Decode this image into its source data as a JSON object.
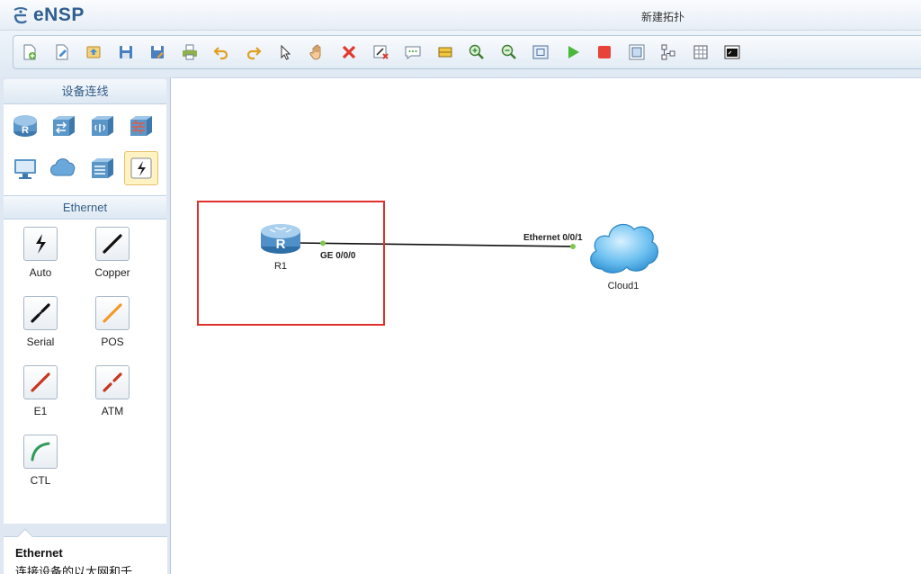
{
  "app": {
    "name": "eNSP",
    "window_title": "新建拓扑"
  },
  "toolbar": {
    "buttons": [
      {
        "name": "new-topology",
        "icon": "new-file-icon"
      },
      {
        "name": "new-exam",
        "icon": "new-exam-icon"
      },
      {
        "name": "open",
        "icon": "open-icon"
      },
      {
        "name": "save",
        "icon": "save-icon"
      },
      {
        "name": "save-as",
        "icon": "save-as-icon"
      },
      {
        "name": "print",
        "icon": "print-icon"
      },
      {
        "name": "undo",
        "icon": "undo-icon"
      },
      {
        "name": "redo",
        "icon": "redo-icon"
      },
      {
        "name": "select",
        "icon": "pointer-icon"
      },
      {
        "name": "pan",
        "icon": "hand-icon"
      },
      {
        "name": "delete",
        "icon": "delete-icon"
      },
      {
        "name": "delete-link",
        "icon": "delete-link-icon"
      },
      {
        "name": "text-note",
        "icon": "comment-icon"
      },
      {
        "name": "draw-shape",
        "icon": "rectangle-icon"
      },
      {
        "name": "zoom-in",
        "icon": "zoom-in-icon"
      },
      {
        "name": "zoom-out",
        "icon": "zoom-out-icon"
      },
      {
        "name": "fit",
        "icon": "fit-icon"
      },
      {
        "name": "start-device",
        "icon": "play-icon"
      },
      {
        "name": "stop-device",
        "icon": "stop-icon"
      },
      {
        "name": "capture",
        "icon": "capture-icon"
      },
      {
        "name": "topology",
        "icon": "topology-icon"
      },
      {
        "name": "grid",
        "icon": "grid-icon"
      },
      {
        "name": "terminal",
        "icon": "terminal-icon"
      }
    ]
  },
  "panel": {
    "device_header": "设备连线",
    "devices": [
      {
        "name": "router",
        "icon": "router-icon"
      },
      {
        "name": "switch",
        "icon": "switch-icon"
      },
      {
        "name": "wlan",
        "icon": "wireless-icon"
      },
      {
        "name": "firewall",
        "icon": "firewall-icon"
      },
      {
        "name": "terminal-pc",
        "icon": "pc-icon"
      },
      {
        "name": "cloud-device",
        "icon": "cloud-icon"
      },
      {
        "name": "other-device",
        "icon": "other-device-icon"
      },
      {
        "name": "connections",
        "icon": "connection-icon",
        "selected": true
      }
    ],
    "category_header": "Ethernet",
    "cables": [
      {
        "label": "Auto",
        "icon": "auto-cable-icon",
        "color": "#111111"
      },
      {
        "label": "Copper",
        "icon": "copper-cable-icon",
        "color": "#111111"
      },
      {
        "label": "Serial",
        "icon": "serial-cable-icon",
        "color": "#111111"
      },
      {
        "label": "POS",
        "icon": "pos-cable-icon",
        "color": "#f39a2a"
      },
      {
        "label": "E1",
        "icon": "e1-cable-icon",
        "color": "#c9361f"
      },
      {
        "label": "ATM",
        "icon": "atm-cable-icon",
        "color": "#c9361f"
      },
      {
        "label": "CTL",
        "icon": "ctl-cable-icon",
        "color": "#2e9a5a"
      }
    ],
    "description": {
      "title": "Ethernet",
      "text": "连接设备的以太网和千"
    }
  },
  "topology": {
    "nodes": [
      {
        "id": "R1",
        "label": "R1",
        "icon": "router-icon"
      },
      {
        "id": "Cloud1",
        "label": "Cloud1",
        "icon": "cloud-icon"
      }
    ],
    "links": [
      {
        "from": "R1",
        "to": "Cloud1",
        "from_port": "GE 0/0/0",
        "to_port": "Ethernet 0/0/1",
        "status_color": "#7ec850"
      }
    ]
  }
}
